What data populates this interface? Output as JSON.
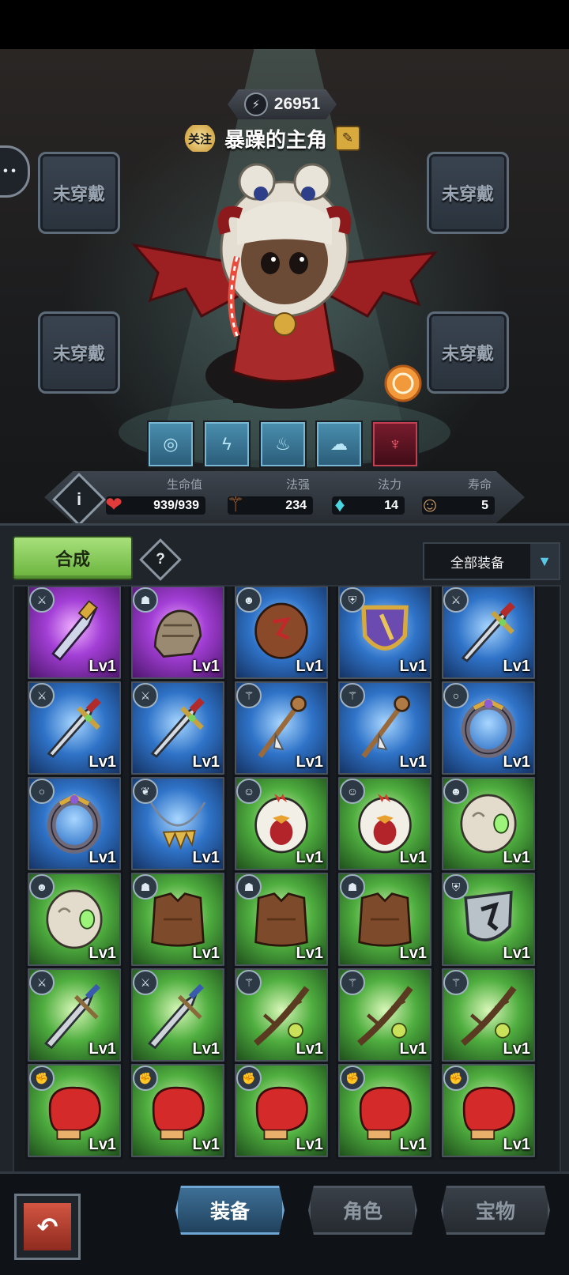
{
  "header": {
    "power_value": "26951",
    "follow_label": "关注",
    "hero_name": "暴躁的主角"
  },
  "slots": {
    "top_left": "未穿戴",
    "top_right": "未穿戴",
    "mid_left": "未穿戴",
    "mid_right": "未穿戴"
  },
  "skills": [
    "swirl-icon",
    "lightning-icon",
    "lamp-icon",
    "storm-icon",
    "demon-icon"
  ],
  "stats": {
    "hp_label": "生命值",
    "hp_value": "939/939",
    "spell_label": "法强",
    "spell_value": "234",
    "mana_label": "法力",
    "mana_value": "14",
    "life_label": "寿命",
    "life_value": "5"
  },
  "toolbar": {
    "merge_label": "合成",
    "help_label": "?",
    "filter_label": "全部装备"
  },
  "inventory": [
    {
      "type": "purple-dagger",
      "rarity": "purple",
      "slot": "weapon",
      "level": "Lv1"
    },
    {
      "type": "gauntlet",
      "rarity": "purple",
      "slot": "armor",
      "level": "Lv1"
    },
    {
      "type": "rune-shield",
      "rarity": "blue",
      "slot": "helmet",
      "level": "Lv1"
    },
    {
      "type": "crest-shield",
      "rarity": "blue",
      "slot": "shield",
      "level": "Lv1"
    },
    {
      "type": "sword",
      "rarity": "blue",
      "slot": "weapon",
      "level": "Lv1"
    },
    {
      "type": "sword",
      "rarity": "blue",
      "slot": "weapon",
      "level": "Lv1"
    },
    {
      "type": "sword",
      "rarity": "blue",
      "slot": "weapon",
      "level": "Lv1"
    },
    {
      "type": "staff",
      "rarity": "blue",
      "slot": "staff",
      "level": "Lv1"
    },
    {
      "type": "staff",
      "rarity": "blue",
      "slot": "staff",
      "level": "Lv1"
    },
    {
      "type": "ring",
      "rarity": "blue",
      "slot": "ring",
      "level": "Lv1"
    },
    {
      "type": "ring",
      "rarity": "blue",
      "slot": "ring",
      "level": "Lv1"
    },
    {
      "type": "necklace",
      "rarity": "blue",
      "slot": "amulet",
      "level": "Lv1"
    },
    {
      "type": "chicken-helmet",
      "rarity": "green",
      "slot": "head",
      "level": "Lv1"
    },
    {
      "type": "chicken-helmet",
      "rarity": "green",
      "slot": "head",
      "level": "Lv1"
    },
    {
      "type": "mask",
      "rarity": "green",
      "slot": "helmet",
      "level": "Lv1"
    },
    {
      "type": "mask",
      "rarity": "green",
      "slot": "helmet",
      "level": "Lv1"
    },
    {
      "type": "leather-armor",
      "rarity": "green",
      "slot": "armor",
      "level": "Lv1"
    },
    {
      "type": "leather-armor",
      "rarity": "green",
      "slot": "armor",
      "level": "Lv1"
    },
    {
      "type": "leather-armor",
      "rarity": "green",
      "slot": "armor",
      "level": "Lv1"
    },
    {
      "type": "iron-shield",
      "rarity": "green",
      "slot": "shield",
      "level": "Lv1"
    },
    {
      "type": "broadsword",
      "rarity": "green",
      "slot": "weapon",
      "level": "Lv1"
    },
    {
      "type": "broadsword",
      "rarity": "green",
      "slot": "weapon",
      "level": "Lv1"
    },
    {
      "type": "branch-staff",
      "rarity": "green",
      "slot": "staff",
      "level": "Lv1"
    },
    {
      "type": "branch-staff",
      "rarity": "green",
      "slot": "staff",
      "level": "Lv1"
    },
    {
      "type": "branch-staff",
      "rarity": "green",
      "slot": "staff",
      "level": "Lv1"
    },
    {
      "type": "boxing-glove",
      "rarity": "green",
      "slot": "glove",
      "level": "Lv1"
    },
    {
      "type": "boxing-glove",
      "rarity": "green",
      "slot": "glove",
      "level": "Lv1"
    },
    {
      "type": "boxing-glove",
      "rarity": "green",
      "slot": "glove",
      "level": "Lv1"
    },
    {
      "type": "boxing-glove",
      "rarity": "green",
      "slot": "glove",
      "level": "Lv1"
    },
    {
      "type": "boxing-glove",
      "rarity": "green",
      "slot": "glove",
      "level": "Lv1"
    }
  ],
  "nav": {
    "tab_equip": "装备",
    "tab_role": "角色",
    "tab_treasure": "宝物"
  }
}
